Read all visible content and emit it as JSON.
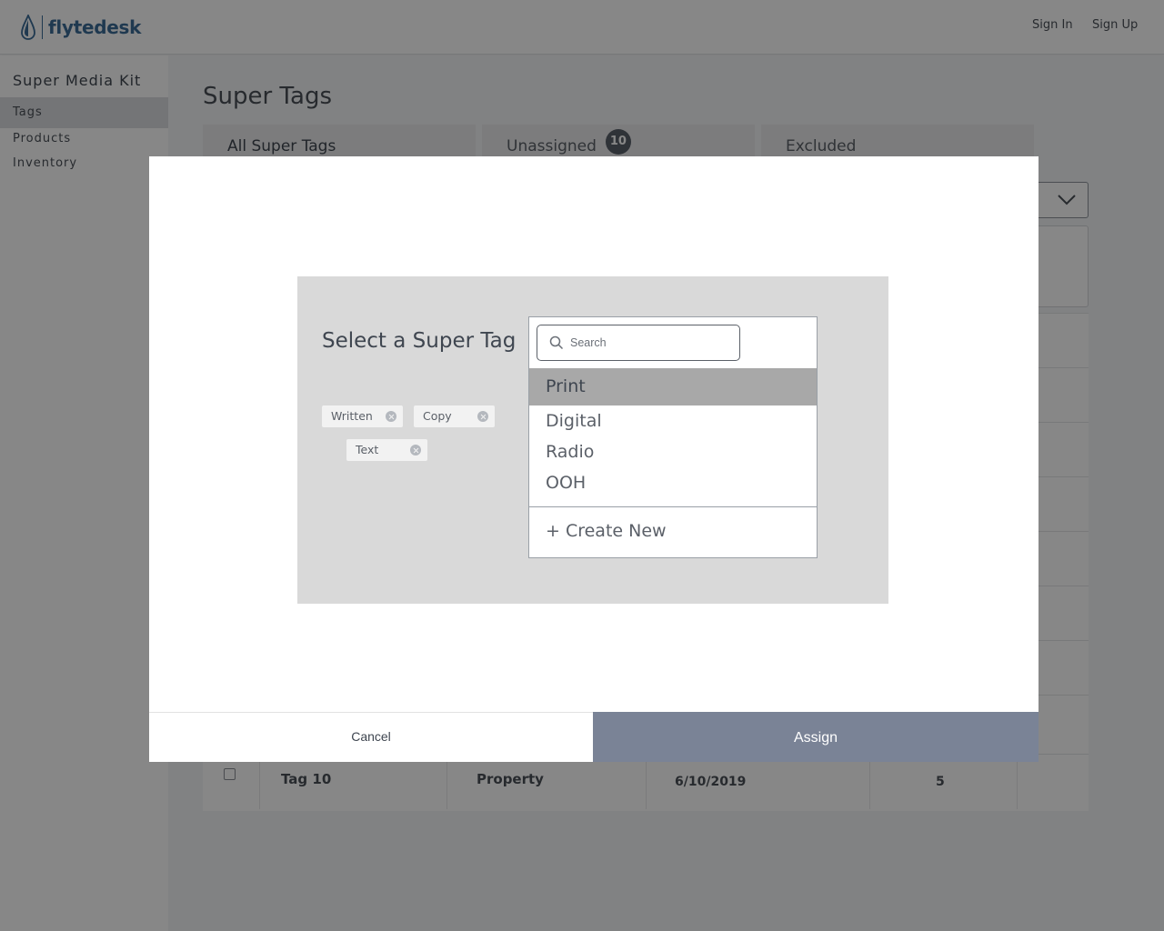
{
  "header": {
    "logo_text": "flytedesk",
    "sign_in": "Sign In",
    "sign_up": "Sign Up"
  },
  "sidebar": {
    "title": "Super Media Kit",
    "items": [
      {
        "label": "Tags",
        "active": true
      },
      {
        "label": "Products",
        "active": false
      },
      {
        "label": "Inventory",
        "active": false
      }
    ]
  },
  "main": {
    "page_title": "Super Tags",
    "tabs": [
      {
        "label": "All Super Tags"
      },
      {
        "label": "Unassigned",
        "badge": "10"
      },
      {
        "label": "Excluded"
      }
    ],
    "table": {
      "visible_row": {
        "name": "Tag 10",
        "type": "Property",
        "date": "6/10/2019",
        "count": "5"
      }
    }
  },
  "modal": {
    "title": "Select a Super Tag",
    "chips": [
      "Written",
      "Copy",
      "Text"
    ],
    "search": {
      "placeholder": "Search",
      "value": ""
    },
    "options": [
      {
        "label": "Print",
        "selected": true
      },
      {
        "label": "Digital",
        "selected": false
      },
      {
        "label": "Radio",
        "selected": false
      },
      {
        "label": "OOH",
        "selected": false
      }
    ],
    "create_new": "+ Create New",
    "cancel_label": "Cancel",
    "assign_label": "Assign"
  },
  "colors": {
    "brand": "#3c6d98",
    "assign_button": "#7a8396",
    "selected_option": "#a8a8a8",
    "badge": "#59606b"
  }
}
